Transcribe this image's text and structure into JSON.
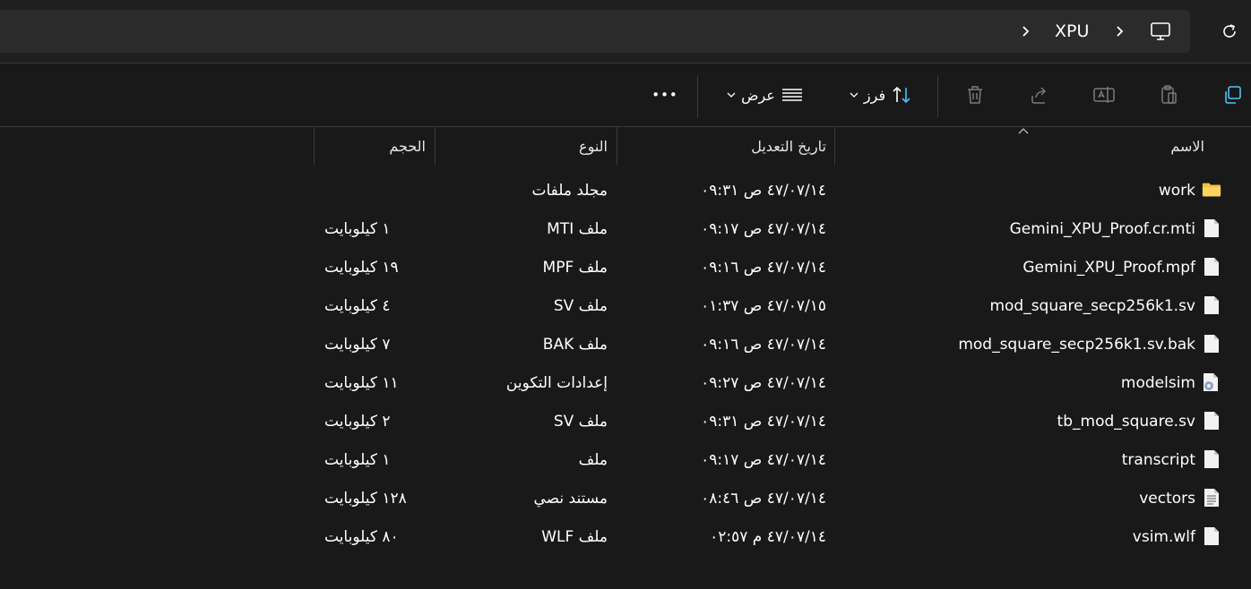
{
  "address": {
    "crumbs": [
      "XPU"
    ],
    "chevron": "chevron-right-icon",
    "root_icon": "monitor-icon",
    "refresh_icon": "refresh-icon"
  },
  "toolbar": {
    "sort_label": "فرز",
    "view_label": "عرض",
    "more_label": "•••"
  },
  "columns": {
    "name": "الاسم",
    "date": "تاريخ التعديل",
    "type": "النوع",
    "size": "الحجم"
  },
  "files": [
    {
      "name": "work",
      "date": "٤٧/٠٧/١٤ ص ٠٩:٣١",
      "type": "مجلد ملفات",
      "size": "",
      "icon": "folder-icon"
    },
    {
      "name": "Gemini_XPU_Proof.cr.mti",
      "date": "٤٧/٠٧/١٤ ص ٠٩:١٧",
      "type": "ملف MTI",
      "size": "١ كيلوبايت",
      "icon": "file-icon"
    },
    {
      "name": "Gemini_XPU_Proof.mpf",
      "date": "٤٧/٠٧/١٤ ص ٠٩:١٦",
      "type": "ملف MPF",
      "size": "١٩ كيلوبايت",
      "icon": "file-icon"
    },
    {
      "name": "mod_square_secp256k1.sv",
      "date": "٤٧/٠٧/١٥ ص ٠١:٣٧",
      "type": "ملف SV",
      "size": "٤ كيلوبايت",
      "icon": "file-icon"
    },
    {
      "name": "mod_square_secp256k1.sv.bak",
      "date": "٤٧/٠٧/١٤ ص ٠٩:١٦",
      "type": "ملف BAK",
      "size": "٧ كيلوبايت",
      "icon": "file-icon"
    },
    {
      "name": "modelsim",
      "date": "٤٧/٠٧/١٤ ص ٠٩:٢٧",
      "type": "إعدادات التكوين",
      "size": "١١ كيلوبايت",
      "icon": "config-file-icon"
    },
    {
      "name": "tb_mod_square.sv",
      "date": "٤٧/٠٧/١٤ ص ٠٩:٣١",
      "type": "ملف SV",
      "size": "٢ كيلوبايت",
      "icon": "file-icon"
    },
    {
      "name": "transcript",
      "date": "٤٧/٠٧/١٤ ص ٠٩:١٧",
      "type": "ملف",
      "size": "١ كيلوبايت",
      "icon": "file-icon"
    },
    {
      "name": "vectors",
      "date": "٤٧/٠٧/١٤ ص ٠٨:٤٦",
      "type": "مستند نصي",
      "size": "١٢٨ كيلوبايت",
      "icon": "text-file-icon"
    },
    {
      "name": "vsim.wlf",
      "date": "٤٧/٠٧/١٤ م ٠٢:٥٧",
      "type": "ملف WLF",
      "size": "٨٠ كيلوبايت",
      "icon": "file-icon"
    }
  ],
  "colors": {
    "background": "#191919",
    "address_field": "#2b2b2b",
    "accent": "#4cc2ff",
    "folder": "#f4c242",
    "disabled_icon": "#7a7a7a"
  }
}
